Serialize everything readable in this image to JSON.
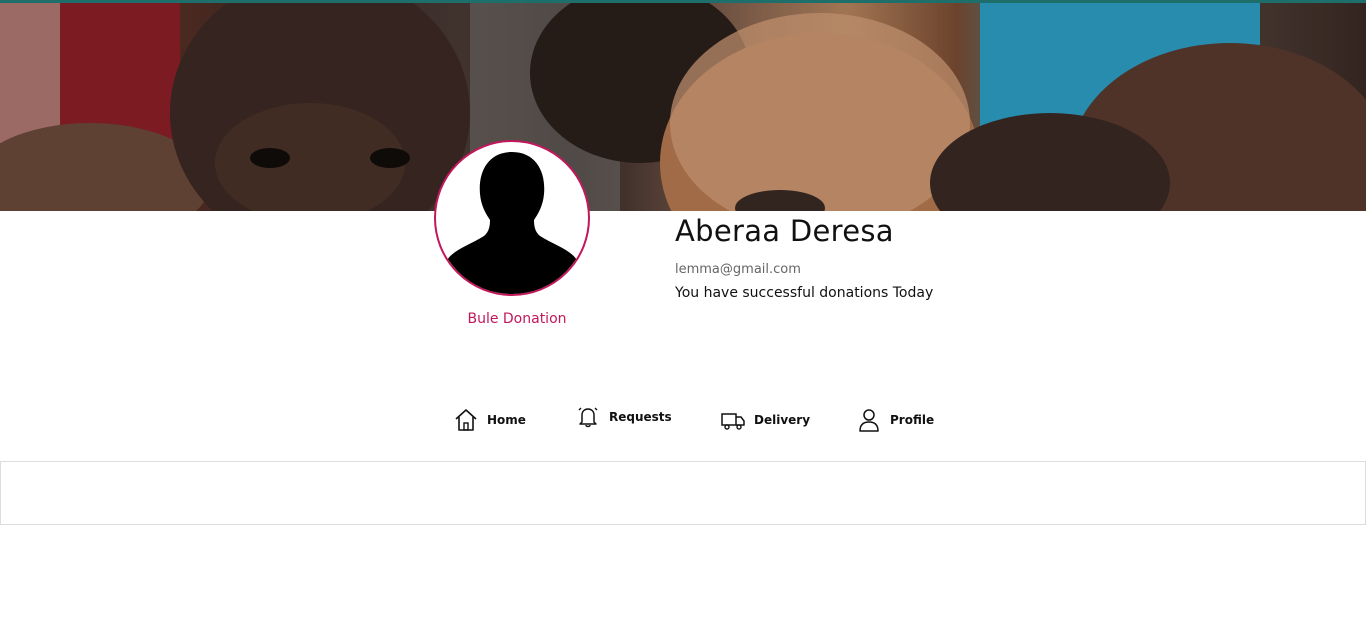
{
  "profile": {
    "name": "Aberaa Deresa",
    "email": "lemma@gmail.com",
    "status": "You have successful donations Today",
    "organization": "Bule Donation"
  },
  "nav": {
    "items": [
      {
        "label": "Home",
        "icon": "home-icon"
      },
      {
        "label": "Requests",
        "icon": "bell-icon"
      },
      {
        "label": "Delivery",
        "icon": "truck-icon"
      },
      {
        "label": "Profile",
        "icon": "user-icon"
      }
    ]
  },
  "colors": {
    "accent": "#c2185b",
    "top_strip": "#1e6f6b"
  }
}
